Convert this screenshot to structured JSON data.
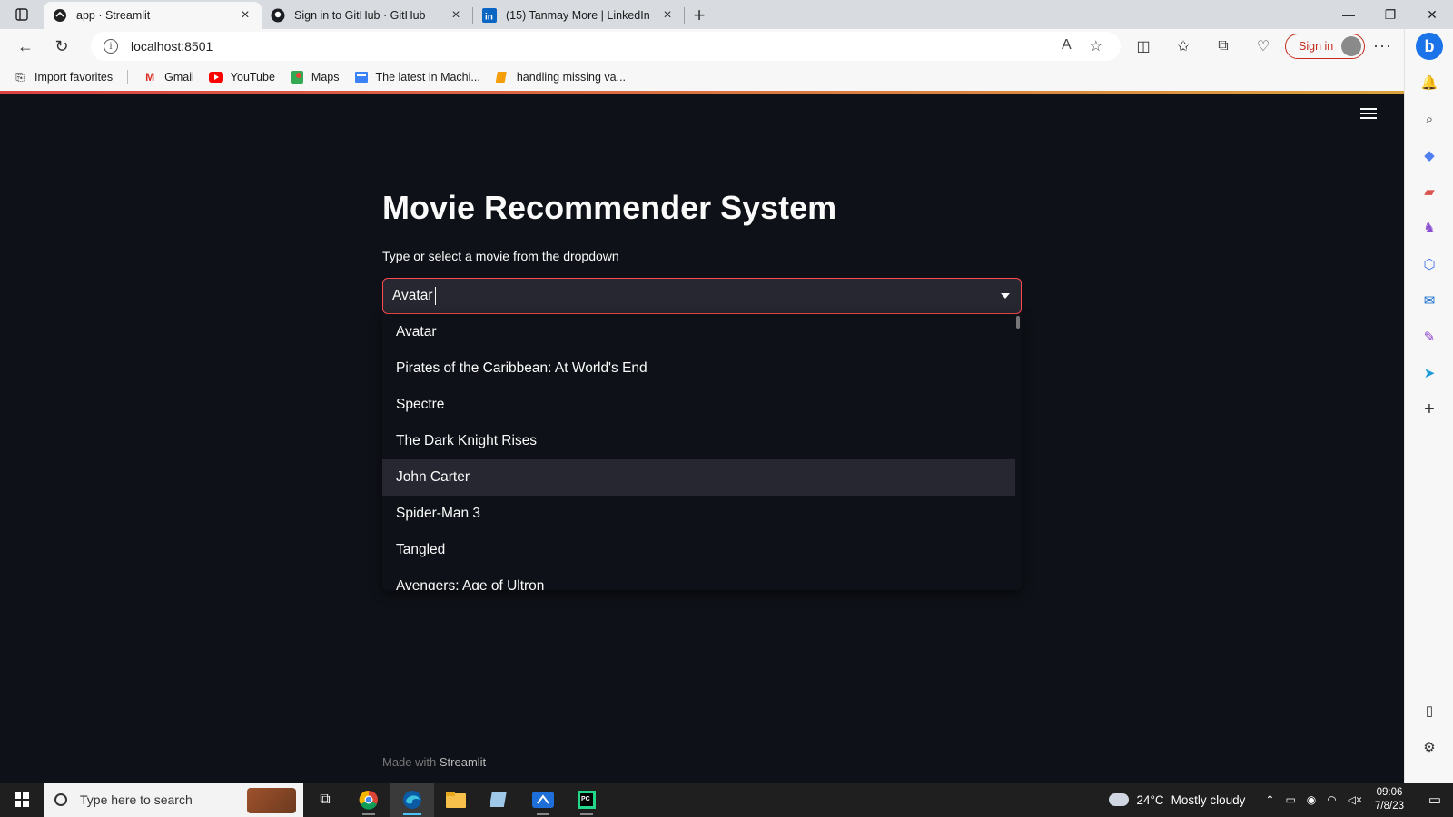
{
  "browser": {
    "tabs": [
      {
        "title": "app · Streamlit",
        "active": true,
        "icon": "streamlit-icon"
      },
      {
        "title": "Sign in to GitHub · GitHub",
        "active": false,
        "icon": "github-icon"
      },
      {
        "title": "(15) Tanmay More | LinkedIn",
        "active": false,
        "icon": "linkedin-icon"
      }
    ],
    "url": "localhost:8501",
    "sign_in_label": "Sign in",
    "favorites": [
      {
        "label": "Import favorites",
        "icon": "import-icon"
      },
      {
        "label": "Gmail",
        "icon": "gmail-icon"
      },
      {
        "label": "YouTube",
        "icon": "youtube-icon"
      },
      {
        "label": "Maps",
        "icon": "maps-icon"
      },
      {
        "label": "The latest in Machi...",
        "icon": "news-icon"
      },
      {
        "label": "handling missing va...",
        "icon": "bookmark-icon"
      }
    ]
  },
  "app": {
    "title": "Movie Recommender System",
    "select_label": "Type or select a movie from the dropdown",
    "select_value": "Avatar",
    "options": [
      "Avatar",
      "Pirates of the Caribbean: At World's End",
      "Spectre",
      "The Dark Knight Rises",
      "John Carter",
      "Spider-Man 3",
      "Tangled",
      "Avengers: Age of Ultron"
    ],
    "hovered_option": "John Carter",
    "footer_prefix": "Made with",
    "footer_link": "Streamlit",
    "accent_color": "#ff4b4b"
  },
  "taskbar": {
    "search_placeholder": "Type here to search",
    "weather_temp": "24°C",
    "weather_text": "Mostly cloudy",
    "time": "09:06",
    "date": "7/8/23"
  }
}
